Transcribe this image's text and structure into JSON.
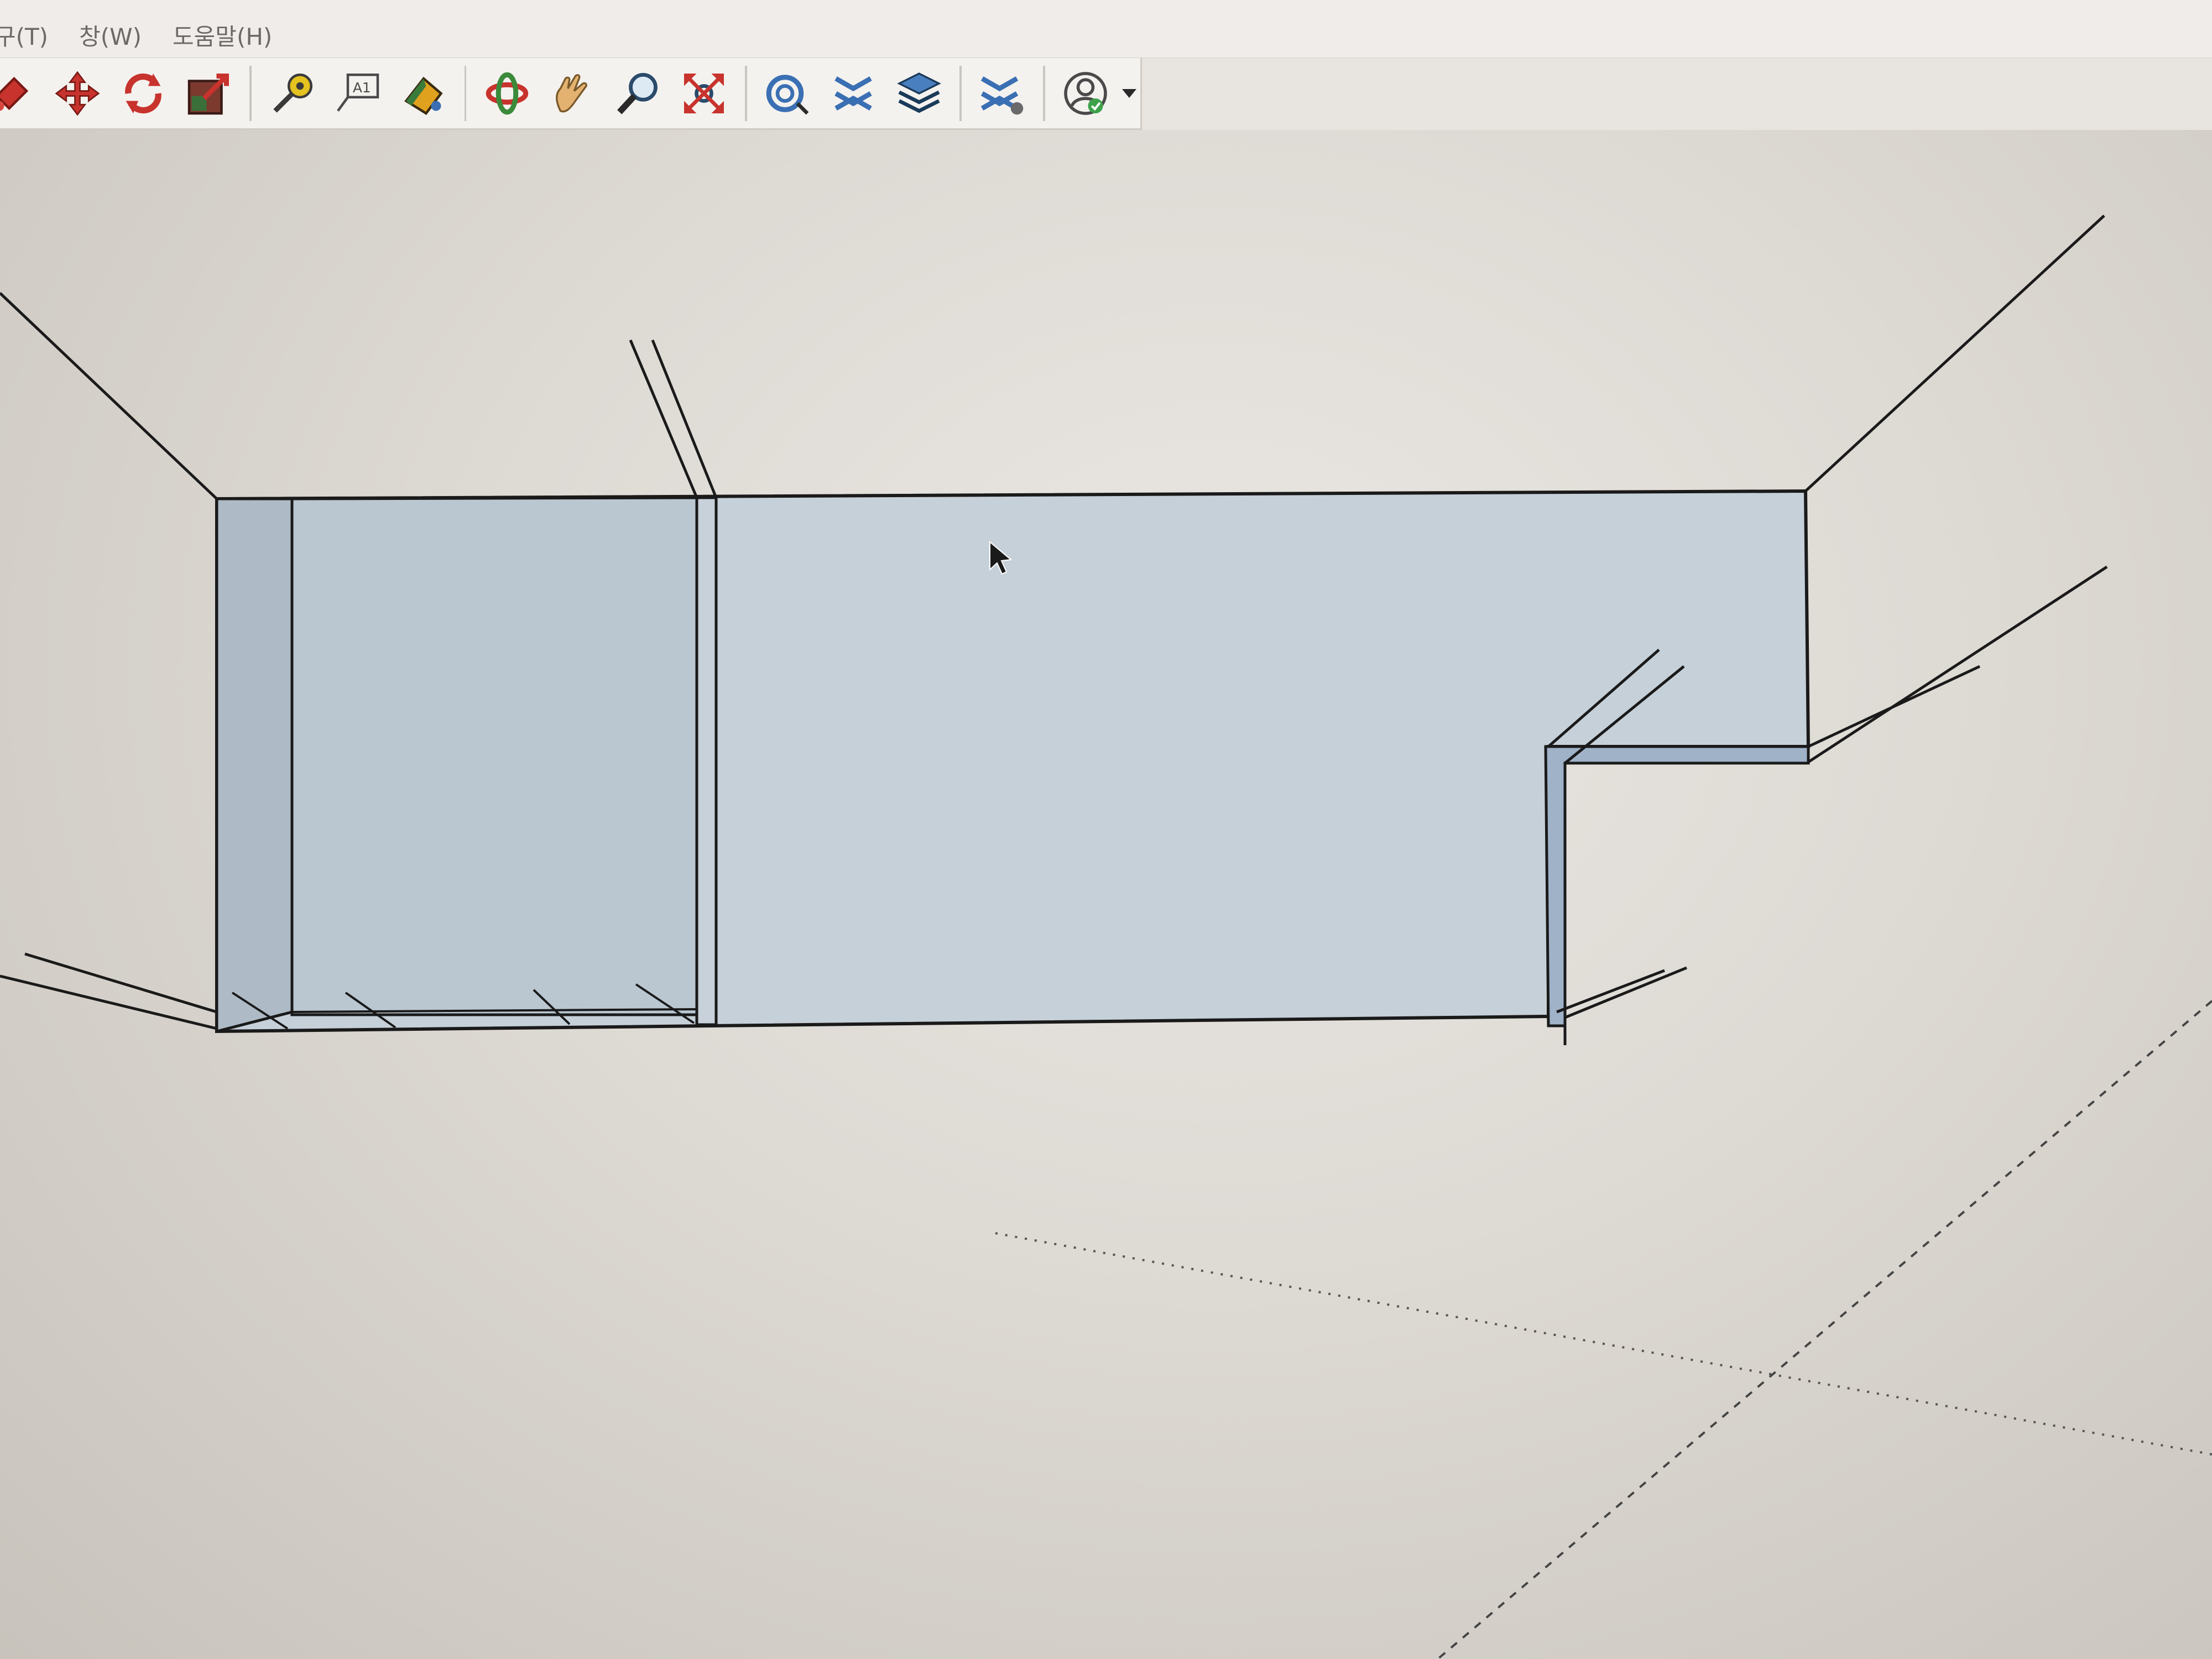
{
  "menubar": {
    "items": [
      {
        "label": "구(T)"
      },
      {
        "label": "창(W)"
      },
      {
        "label": "도움말(H)"
      }
    ]
  },
  "toolbar": {
    "groups": [
      [
        "paint-bucket-icon",
        "move-icon",
        "rotate-icon",
        "scale-icon"
      ],
      [
        "tape-measure-icon",
        "text-label-icon",
        "paint-icon"
      ],
      [
        "orbit-icon",
        "pan-icon",
        "zoom-icon",
        "zoom-extents-icon"
      ],
      [
        "section-plane-icon",
        "section-display-icon",
        "layers-icon",
        "section-settings-icon"
      ],
      [
        "account-icon"
      ]
    ]
  },
  "colors": {
    "wall_face": "#b9c6d2",
    "wall_face_light": "#cdd6de",
    "edge": "#1a1a1a",
    "accent_red": "#c8332d",
    "accent_blue": "#3a6fb3",
    "accent_green": "#3da24a"
  }
}
